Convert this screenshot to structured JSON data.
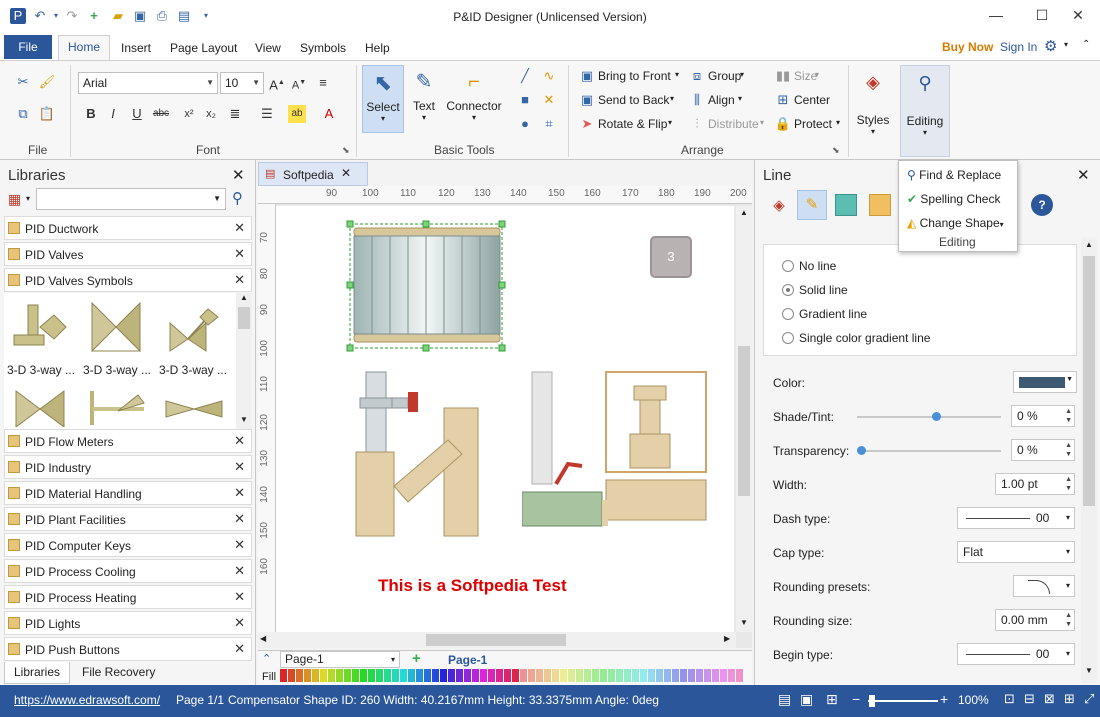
{
  "window": {
    "title": "P&ID Designer (Unlicensed Version)",
    "minimize": "—",
    "maximize": "☐",
    "close": "✕"
  },
  "ribbon_tabs": {
    "file": "File",
    "home": "Home",
    "insert": "Insert",
    "page_layout": "Page Layout",
    "view": "View",
    "symbols": "Symbols",
    "help": "Help",
    "buy_now": "Buy Now",
    "sign_in": "Sign In"
  },
  "ribbon": {
    "file_group": "File",
    "font_group": "Font",
    "font_name": "Arial",
    "font_size": "10",
    "basic_tools_group": "Basic Tools",
    "select": "Select",
    "text": "Text",
    "connector": "Connector",
    "arrange_group": "Arrange",
    "bring_to_front": "Bring to Front",
    "send_to_back": "Send to Back",
    "rotate_flip": "Rotate & Flip",
    "group": "Group",
    "align": "Align",
    "distribute": "Distribute",
    "size": "Size",
    "center": "Center",
    "protect": "Protect",
    "styles": "Styles",
    "editing": "Editing"
  },
  "editing_menu": {
    "find_replace": "Find & Replace",
    "spelling_check": "Spelling Check",
    "change_shape": "Change Shape",
    "group_label": "Editing"
  },
  "libraries": {
    "title": "Libraries",
    "expanded_items": [
      "PID Ductwork",
      "PID Valves",
      "PID Valves Symbols"
    ],
    "shape_labels": [
      "3-D 3-way ...",
      "3-D 3-way ...",
      "3-D 3-way ..."
    ],
    "collapsed_items": [
      "PID Flow Meters",
      "PID Industry",
      "PID Material Handling",
      "PID Plant Facilities",
      "PID Computer Keys",
      "PID Process Cooling",
      "PID Process Heating",
      "PID Lights",
      "PID Push Buttons"
    ],
    "tab_libraries": "Libraries",
    "tab_file_recovery": "File Recovery"
  },
  "document": {
    "tab_name": "Softpedia",
    "ruler_top": [
      "90",
      "100",
      "110",
      "120",
      "130",
      "140",
      "150",
      "160",
      "170",
      "180",
      "190",
      "200"
    ],
    "ruler_left": [
      "70",
      "80",
      "90",
      "100",
      "110",
      "120",
      "130",
      "140",
      "150",
      "160"
    ],
    "badge": "3",
    "canvas_text": "This is a Softpedia Test",
    "page_select": "Page-1",
    "page_tab": "Page-1",
    "fill_label": "Fill"
  },
  "right_panel": {
    "title": "Line",
    "options": [
      "No line",
      "Solid line",
      "Gradient line",
      "Single color gradient line"
    ],
    "selected_option": "Solid line",
    "color_label": "Color:",
    "line_color": "#3e5a72",
    "shade_label": "Shade/Tint:",
    "shade_value": "0 %",
    "shade_level": 0.55,
    "transparency_label": "Transparency:",
    "transparency_value": "0 %",
    "transparency_level": 0.0,
    "width_label": "Width:",
    "width_value": "1.00 pt",
    "dash_label": "Dash type:",
    "dash_value": "00",
    "cap_label": "Cap type:",
    "cap_value": "Flat",
    "rounding_presets_label": "Rounding presets:",
    "rounding_size_label": "Rounding size:",
    "rounding_size_value": "0.00 mm",
    "begin_type_label": "Begin type:",
    "begin_type_value": "00"
  },
  "statusbar": {
    "url": "https://www.edrawsoft.com/",
    "page": "Page 1/1",
    "info": "Compensator  Shape ID: 260  Width: 40.2167mm  Height: 33.3375mm  Angle: 0deg",
    "zoom": "100%"
  },
  "colors": {
    "ribbon_blue": "#2b579a",
    "buy_now": "#d67b00",
    "canvas_text": "#e00000",
    "slider_knob": "#4a90d9"
  }
}
